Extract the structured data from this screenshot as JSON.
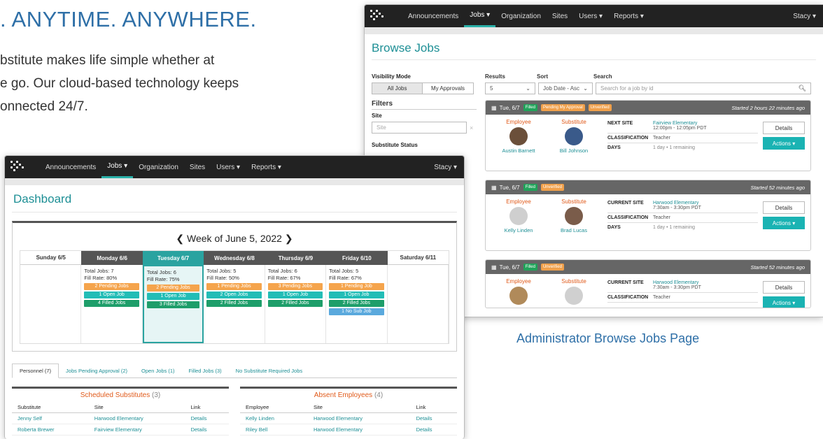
{
  "hero": {
    "title": ". ANYTIME. ANYWHERE.",
    "body_lines": [
      "bstitute makes life simple whether at",
      "e go. Our cloud-based technology keeps",
      "onnected 24/7."
    ]
  },
  "caption": "Administrator Browse Jobs Page",
  "browse": {
    "nav": {
      "items": [
        "Announcements",
        "Jobs ▾",
        "Organization",
        "Sites",
        "Users ▾",
        "Reports ▾"
      ],
      "user": "Stacy ▾"
    },
    "title": "Browse Jobs",
    "visibility_label": "Visibility Mode",
    "vis_all": "All Jobs",
    "vis_mine": "My Approvals",
    "filters_label": "Filters",
    "site_label": "Site",
    "site_placeholder": "Site",
    "sub_status_label": "Substitute Status",
    "results_label": "Results",
    "results_value": "5",
    "sort_label": "Sort",
    "sort_value": "Job Date - Asc",
    "search_label": "Search",
    "search_placeholder": "Search for a job by id",
    "employee_role": "Employee",
    "substitute_role": "Substitute",
    "details_label": "Details",
    "actions_label": "Actions ▾",
    "jobs": [
      {
        "date": "Tue, 6/7",
        "badges": [
          "Filled",
          "Pending My Approval",
          "Unverified"
        ],
        "started": "Started 2 hours 22 minutes ago",
        "employee": "Austin Barnett",
        "substitute": "Bill Johnson",
        "site_key": "NEXT SITE",
        "site": "Fairview Elementary",
        "time": "12:00pm - 12:05pm PDT",
        "class_key": "CLASSIFICATION",
        "classification": "Teacher",
        "days_key": "DAYS",
        "days": "1 day  •  1 remaining"
      },
      {
        "date": "Tue, 6/7",
        "badges": [
          "Filled",
          "Unverified"
        ],
        "started": "Started 52 minutes ago",
        "employee": "Kelly Linden",
        "substitute": "Brad Lucas",
        "site_key": "CURRENT SITE",
        "site": "Harwood Elementary",
        "time": "7:30am - 3:30pm PDT",
        "class_key": "CLASSIFICATION",
        "classification": "Teacher",
        "days_key": "DAYS",
        "days": "1 day  •  1 remaining"
      },
      {
        "date": "Tue, 6/7",
        "badges": [
          "Filled",
          "Unverified"
        ],
        "started": "Started 52 minutes ago",
        "employee": "",
        "substitute": "",
        "site_key": "CURRENT SITE",
        "site": "Harwood Elementary",
        "time": "7:30am - 3:30pm PDT",
        "class_key": "CLASSIFICATION",
        "classification": "Teacher",
        "days_key": "",
        "days": ""
      }
    ]
  },
  "dashboard": {
    "nav": {
      "items": [
        "Announcements",
        "Jobs ▾",
        "Organization",
        "Sites",
        "Users ▾",
        "Reports ▾"
      ],
      "user": "Stacy ▾"
    },
    "title": "Dashboard",
    "week_label": "Week of June 5, 2022",
    "days": [
      {
        "label": "Sunday 6/5",
        "lines": [],
        "pills": []
      },
      {
        "label": "Monday 6/6",
        "lines": [
          "Total Jobs: 7",
          "Fill Rate: 80%"
        ],
        "pills": [
          [
            "pend",
            "2 Pending Jobs"
          ],
          [
            "open",
            "1 Open Job"
          ],
          [
            "fill",
            "4 Filled Jobs"
          ]
        ]
      },
      {
        "label": "Tuesday 6/7",
        "today": true,
        "lines": [
          "Total Jobs: 6",
          "Fill Rate: 75%"
        ],
        "pills": [
          [
            "pend",
            "2 Pending Jobs"
          ],
          [
            "open",
            "1 Open Job"
          ],
          [
            "fill",
            "3 Filled Jobs"
          ]
        ]
      },
      {
        "label": "Wednesday 6/8",
        "lines": [
          "Total Jobs: 5",
          "Fill Rate: 50%"
        ],
        "pills": [
          [
            "pend",
            "1 Pending Jobs"
          ],
          [
            "open",
            "2 Open Jobs"
          ],
          [
            "fill",
            "2 Filled Jobs"
          ]
        ]
      },
      {
        "label": "Thursday 6/9",
        "lines": [
          "Total Jobs: 6",
          "Fill Rate: 67%"
        ],
        "pills": [
          [
            "pend",
            "3 Pending Jobs"
          ],
          [
            "open",
            "1 Open Job"
          ],
          [
            "fill",
            "2 Filled Jobs"
          ]
        ]
      },
      {
        "label": "Friday 6/10",
        "lines": [
          "Total Jobs: 5",
          "Fill Rate: 67%"
        ],
        "pills": [
          [
            "pend",
            "1 Pending Job"
          ],
          [
            "open",
            "1 Open Job"
          ],
          [
            "fill",
            "2 Filled Jobs"
          ],
          [
            "nosub",
            "1 No Sub Job"
          ]
        ]
      },
      {
        "label": "Saturday 6/11",
        "lines": [],
        "pills": []
      }
    ],
    "tabs": [
      "Personnel (7)",
      "Jobs Pending Approval (2)",
      "Open Jobs (1)",
      "Filled Jobs (3)",
      "No Substitute Required Jobs"
    ],
    "scheduled": {
      "title": "Scheduled Substitutes",
      "count": "(3)",
      "headers": [
        "Substitute",
        "Site",
        "Link"
      ],
      "rows": [
        [
          "Jenny Self",
          "Harwood Elementary",
          "Details"
        ],
        [
          "Roberta Brewer",
          "Fairview Elementary",
          "Details"
        ]
      ]
    },
    "absent": {
      "title": "Absent Employees",
      "count": "(4)",
      "headers": [
        "Employee",
        "Site",
        "Link"
      ],
      "rows": [
        [
          "Kelly Linden",
          "Harwood Elementary",
          "Details"
        ],
        [
          "Riley Bell",
          "Harwood Elementary",
          "Details"
        ]
      ]
    }
  }
}
